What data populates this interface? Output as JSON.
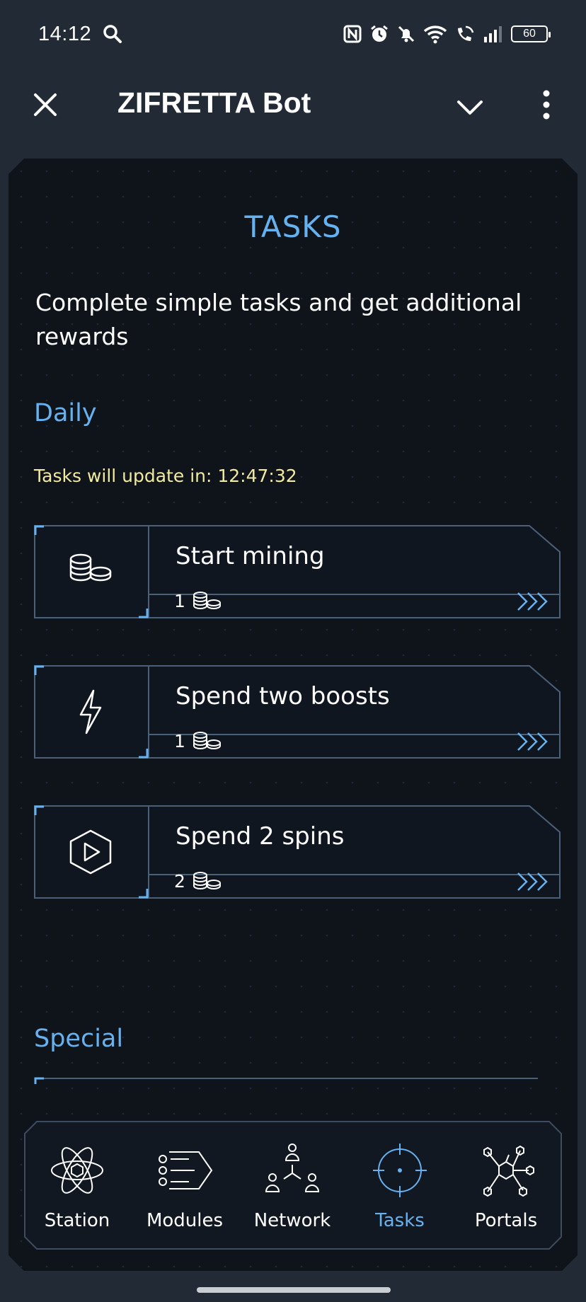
{
  "status_bar": {
    "time": "14:12",
    "battery": "60"
  },
  "header": {
    "title": "ZIFRETTA Bot"
  },
  "page": {
    "title": "TASKS",
    "subtitle": "Complete simple tasks and get additional rewards",
    "daily_heading": "Daily",
    "update_text": "Tasks will update in: 12:47:32",
    "special_heading": "Special"
  },
  "tasks": [
    {
      "title": "Start mining",
      "reward": "1",
      "icon": "coins-icon"
    },
    {
      "title": "Spend two boosts",
      "reward": "1",
      "icon": "lightning-icon"
    },
    {
      "title": "Spend 2 spins",
      "reward": "2",
      "icon": "play-hexagon-icon"
    }
  ],
  "nav": [
    {
      "label": "Station",
      "icon": "atom-icon"
    },
    {
      "label": "Modules",
      "icon": "modules-icon"
    },
    {
      "label": "Network",
      "icon": "network-icon"
    },
    {
      "label": "Tasks",
      "icon": "crosshair-icon",
      "active": true
    },
    {
      "label": "Portals",
      "icon": "portals-icon"
    }
  ],
  "colors": {
    "accent": "#66b2f0",
    "timer": "#f1ea9f",
    "panel": "#0f131a",
    "frame": "#4a6079"
  }
}
